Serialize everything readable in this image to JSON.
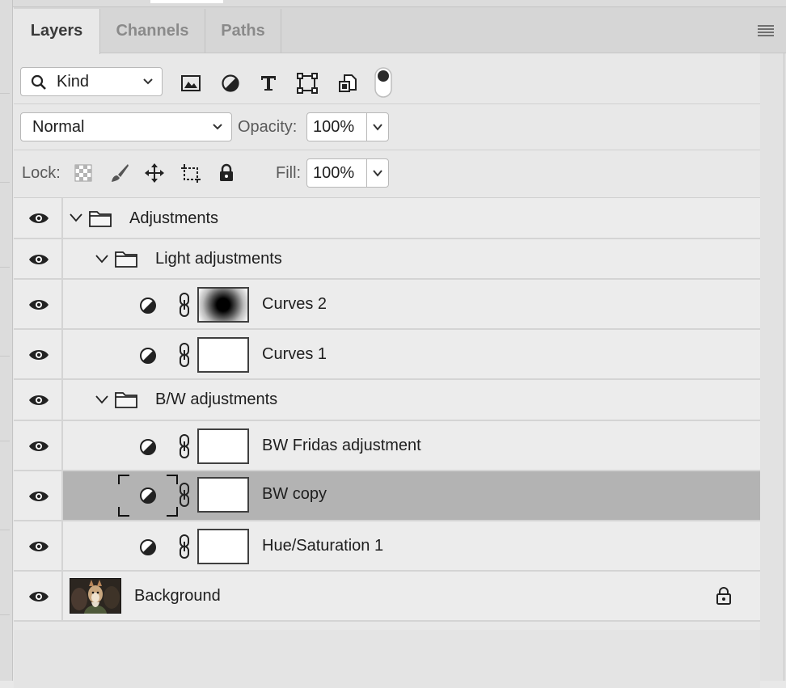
{
  "tabs": [
    {
      "label": "Layers",
      "active": true
    },
    {
      "label": "Channels",
      "active": false
    },
    {
      "label": "Paths",
      "active": false
    }
  ],
  "filter": {
    "kind_label": "Kind",
    "icons": [
      "image-filter-icon",
      "adjustment-filter-icon",
      "type-filter-icon",
      "shape-filter-icon",
      "smart-object-filter-icon",
      "filter-toggle-icon"
    ]
  },
  "blend": {
    "mode": "Normal",
    "opacity_label": "Opacity:",
    "opacity_value": "100%"
  },
  "lock": {
    "label": "Lock:",
    "icons": [
      "lock-transparent-pixels-icon",
      "lock-image-pixels-icon",
      "lock-position-icon",
      "lock-artboard-icon",
      "lock-all-icon"
    ],
    "fill_label": "Fill:",
    "fill_value": "100%"
  },
  "layers": [
    {
      "name": "Adjustments",
      "type": "group",
      "indent": 0
    },
    {
      "name": "Light adjustments",
      "type": "group",
      "indent": 1
    },
    {
      "name": "Curves 2",
      "type": "adjustment",
      "mask": "radial"
    },
    {
      "name": "Curves 1",
      "type": "adjustment",
      "mask": "white"
    },
    {
      "name": "B/W adjustments",
      "type": "group",
      "indent": 1
    },
    {
      "name": "BW Fridas adjustment",
      "type": "adjustment",
      "mask": "white"
    },
    {
      "name": "BW copy",
      "type": "adjustment",
      "mask": "white",
      "selected": true
    },
    {
      "name": "Hue/Saturation 1",
      "type": "adjustment",
      "mask": "white"
    },
    {
      "name": "Background",
      "type": "image",
      "locked": true
    }
  ],
  "colors": {
    "panel_bg": "#e8e8e8",
    "selected_row": "#b3b3b3",
    "tab_inactive": "#8a8a8a"
  }
}
